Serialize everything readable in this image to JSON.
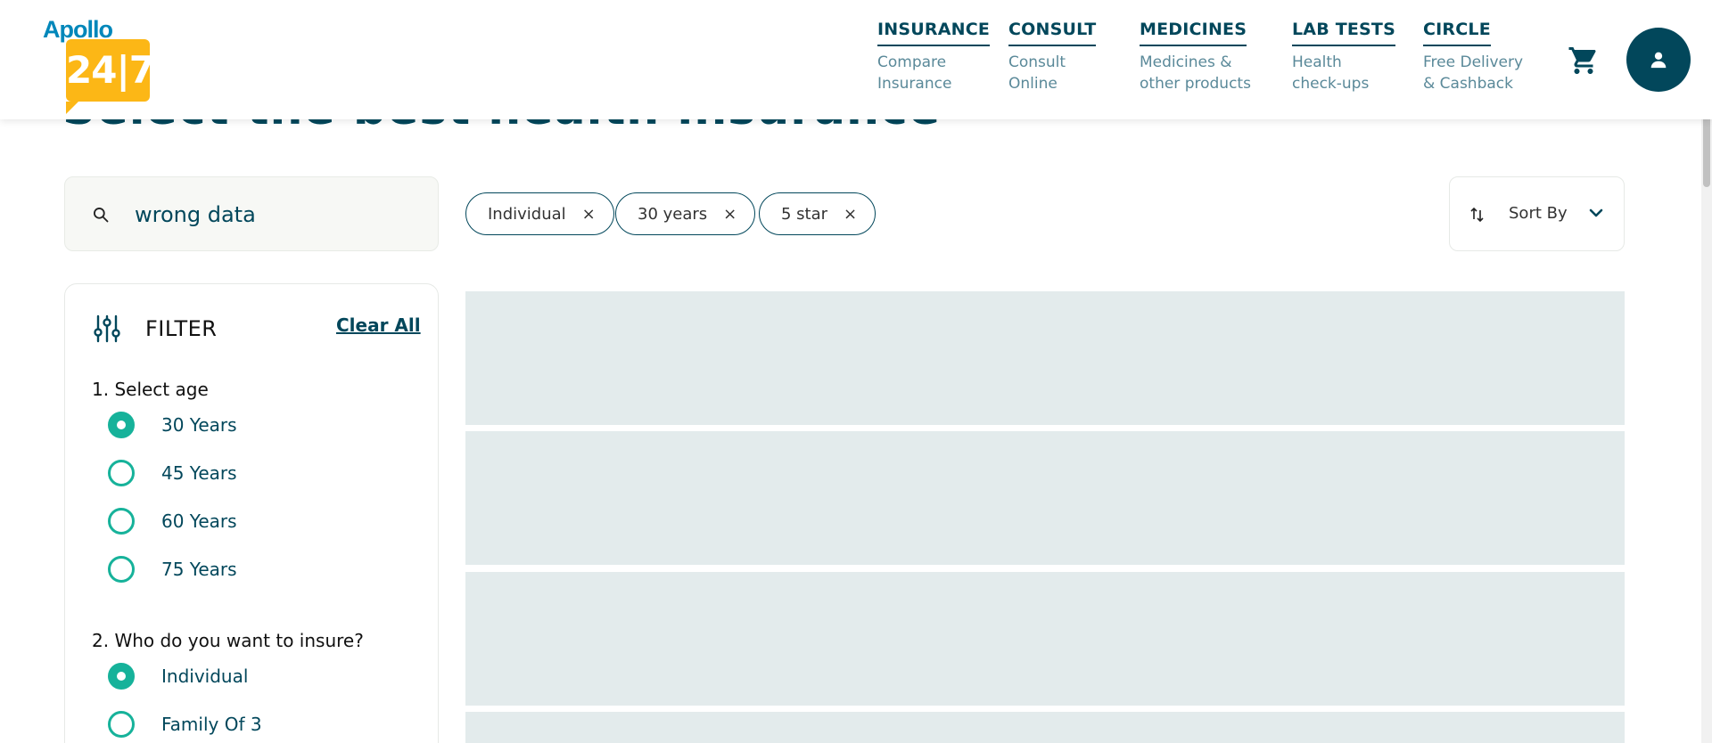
{
  "page": {
    "heading": "Select the best health insurance"
  },
  "header": {
    "logo_word": "Apollo",
    "logo_number": "24|7",
    "nav": [
      {
        "title": "INSURANCE",
        "subtitle": "Compare\nInsurance"
      },
      {
        "title": "CONSULT",
        "subtitle": "Consult\nOnline"
      },
      {
        "title": "MEDICINES",
        "subtitle": "Medicines &\nother products"
      },
      {
        "title": "LAB TESTS",
        "subtitle": "Health\ncheck-ups"
      },
      {
        "title": "CIRCLE",
        "subtitle": "Free Delivery\n& Cashback"
      }
    ],
    "cart_icon": "cart-icon",
    "avatar_icon": "user-icon"
  },
  "search": {
    "value": "wrong data",
    "icon": "search-icon"
  },
  "chips": [
    {
      "label": "Individual",
      "remove": "×"
    },
    {
      "label": "30 years",
      "remove": "×"
    },
    {
      "label": "5 star",
      "remove": "×"
    }
  ],
  "sort": {
    "label": "Sort By",
    "icon": "sort-icon",
    "chevron": "chevron-down-icon"
  },
  "filter": {
    "title": "FILTER",
    "clear_all": "Clear All",
    "sections": [
      {
        "title": "1. Select age",
        "options": [
          {
            "label": "30 Years",
            "checked": true
          },
          {
            "label": "45 Years",
            "checked": false
          },
          {
            "label": "60 Years",
            "checked": false
          },
          {
            "label": "75 Years",
            "checked": false
          }
        ]
      },
      {
        "title": "2. Who do you want to insure?",
        "options": [
          {
            "label": "Individual",
            "checked": true
          },
          {
            "label": "Family Of 3",
            "checked": false
          }
        ]
      }
    ]
  },
  "colors": {
    "brand_dark": "#02475b",
    "accent_green": "#16b29a",
    "logo_yellow": "#fcb716",
    "logo_blue": "#0087ba",
    "skeleton": "#e3ebec"
  }
}
